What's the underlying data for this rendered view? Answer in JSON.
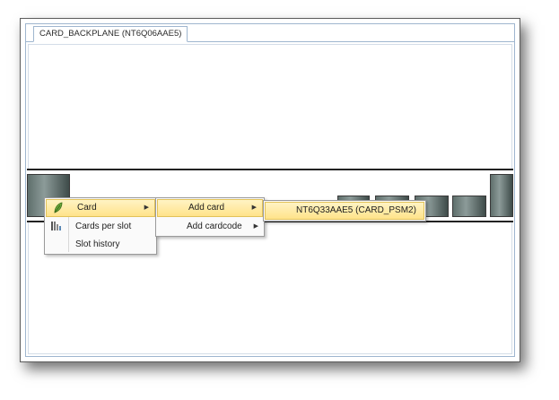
{
  "window": {
    "tab_label": "CARD_BACKPLANE (NT6Q06AAE5)"
  },
  "context_menu": {
    "items": [
      {
        "label": "Card",
        "icon": "card-leaf-icon",
        "has_submenu": true,
        "highlighted": true
      },
      {
        "label": "Cards per slot",
        "icon": "cards-per-slot-icon",
        "has_submenu": false,
        "highlighted": false
      },
      {
        "label": "Slot history",
        "icon": "",
        "has_submenu": false,
        "highlighted": false
      }
    ]
  },
  "card_submenu": {
    "items": [
      {
        "label": "Add card",
        "has_submenu": true,
        "highlighted": true
      },
      {
        "label": "Add cardcode",
        "has_submenu": true,
        "highlighted": false
      }
    ]
  },
  "add_card_submenu": {
    "items": [
      {
        "label": "NT6Q33AAE5 (CARD_PSM2)",
        "highlighted": true
      }
    ]
  },
  "colors": {
    "highlight": "#ffe38a",
    "slot": "#5f6f6c",
    "frame_border": "#9fb6cf"
  }
}
